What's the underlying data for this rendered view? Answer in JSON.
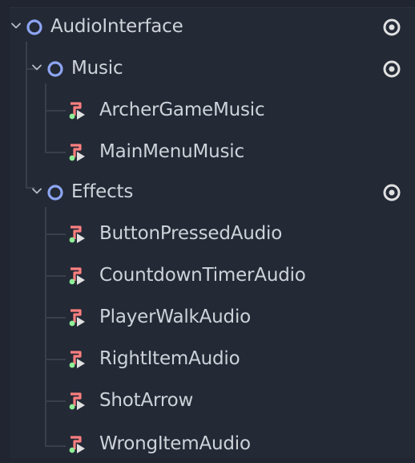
{
  "colors": {
    "background": "#232935",
    "text": "#ced2d9",
    "node_icon": "#8da5f3",
    "visibility_icon": "#e0e0e0",
    "audio_icon_red": "#fc7f7f",
    "audio_icon_green": "#8eef97",
    "guide_line": "#3a404b"
  },
  "tree": {
    "root": {
      "label": "AudioInterface",
      "icon": "node-circle-icon",
      "expanded": true,
      "visible": true
    },
    "groups": [
      {
        "label": "Music",
        "icon": "node-circle-icon",
        "expanded": true,
        "visible": true,
        "children": [
          {
            "label": "ArcherGameMusic",
            "icon": "audio-stream-player-icon"
          },
          {
            "label": "MainMenuMusic",
            "icon": "audio-stream-player-icon"
          }
        ]
      },
      {
        "label": "Effects",
        "icon": "node-circle-icon",
        "expanded": true,
        "visible": true,
        "children": [
          {
            "label": "ButtonPressedAudio",
            "icon": "audio-stream-player-icon"
          },
          {
            "label": "CountdownTimerAudio",
            "icon": "audio-stream-player-icon"
          },
          {
            "label": "PlayerWalkAudio",
            "icon": "audio-stream-player-icon"
          },
          {
            "label": "RightItemAudio",
            "icon": "audio-stream-player-icon"
          },
          {
            "label": "ShotArrow",
            "icon": "audio-stream-player-icon"
          },
          {
            "label": "WrongItemAudio",
            "icon": "audio-stream-player-icon"
          }
        ]
      }
    ]
  }
}
